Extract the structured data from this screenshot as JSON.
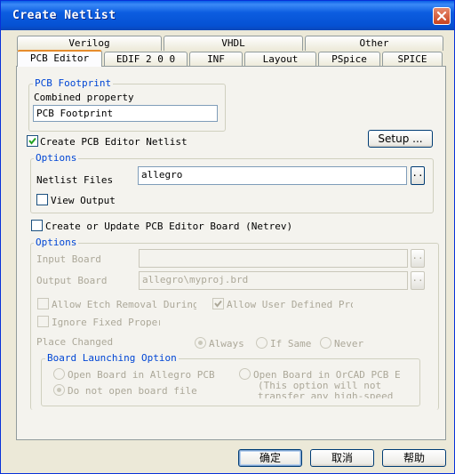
{
  "window": {
    "title": "Create Netlist"
  },
  "tabs": {
    "row1": [
      "Verilog",
      "VHDL",
      "Other"
    ],
    "row2": [
      "PCB Editor",
      "EDIF 2 0 0",
      "INF",
      "Layout",
      "PSpice",
      "SPICE"
    ],
    "active": "PCB Editor"
  },
  "pcb_footprint": {
    "legend": "PCB Footprint",
    "combined_label": "Combined property",
    "combined_value": "PCB Footprint"
  },
  "create_netlist": {
    "label": "Create PCB Editor Netlist",
    "checked": true
  },
  "setup_button": "Setup ...",
  "options1": {
    "legend": "Options",
    "netlist_files_label": "Netlist Files",
    "netlist_files_value": "allegro",
    "browse": "..",
    "view_output_label": "View Output"
  },
  "create_board": {
    "label": "Create or Update PCB Editor Board (Netrev)",
    "checked": false
  },
  "options2": {
    "legend": "Options",
    "input_board_label": "Input Board",
    "input_board_value": "",
    "output_board_label": "Output Board",
    "output_board_value": "allegro\\myproj.brd",
    "browse": "..",
    "allow_etch_label": "Allow Etch Removal During E",
    "allow_user_label": "Allow User Defined Prop",
    "ignore_fixed_label": "Ignore Fixed Propert",
    "place_changed_label": "Place Changed",
    "radio_always": "Always",
    "radio_if_same": "If Same",
    "radio_never": "Never",
    "launch_legend": "Board Launching Option",
    "open_allegro": "Open Board in Allegro PCB Ed",
    "open_orcad": "Open Board in OrCAD PCB Edi",
    "orcad_note_1": "(This option will not",
    "orcad_note_2": "transfer any high-speed",
    "do_not_open": "Do not open board file"
  },
  "buttons": {
    "ok": "确定",
    "cancel": "取消",
    "help": "帮助"
  }
}
